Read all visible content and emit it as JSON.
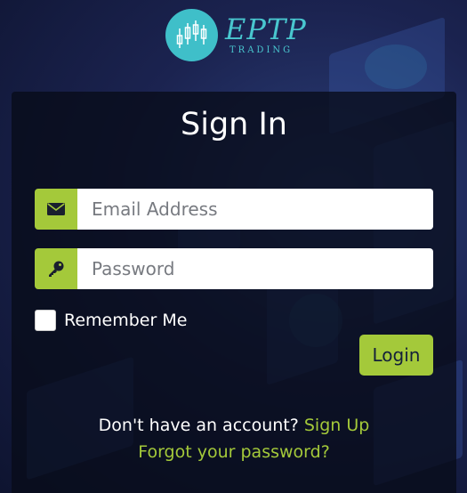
{
  "brand": {
    "name": "EPTP",
    "tagline": "TRADING"
  },
  "form": {
    "title": "Sign In",
    "email_placeholder": "Email Address",
    "password_placeholder": "Password",
    "remember_label": "Remember Me",
    "login_label": "Login"
  },
  "footer": {
    "signup_prompt": "Don't have an account?",
    "signup_link": "Sign Up",
    "forgot_link": "Forgot your password?"
  },
  "colors": {
    "accent": "#a4c93a",
    "logo": "#3fbfc9",
    "card_bg": "rgba(8, 12, 24, 0.78)"
  },
  "icons": {
    "email": "envelope-icon",
    "password": "key-icon",
    "logo": "candlestick-chart-icon"
  }
}
